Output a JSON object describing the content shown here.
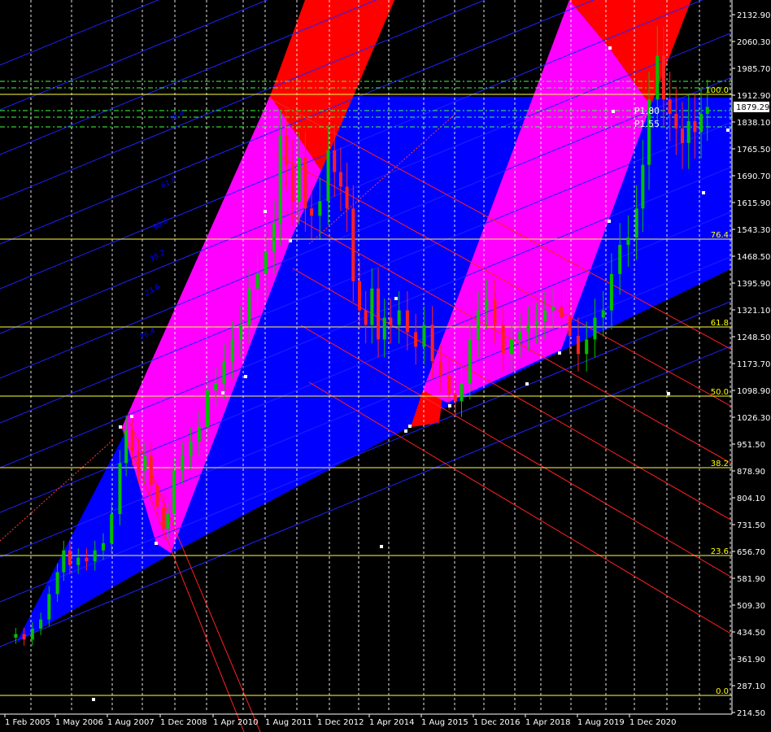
{
  "chart_data": {
    "type": "candlestick",
    "instrument": "",
    "price_axis": {
      "ticks": [
        "2132.90",
        "2060.30",
        "1985.70",
        "1912.90",
        "1838.10",
        "1765.50",
        "1690.70",
        "1615.90",
        "1543.30",
        "1468.50",
        "1395.90",
        "1321.10",
        "1248.50",
        "1173.70",
        "1098.90",
        "1026.30",
        "951.50",
        "878.90",
        "804.10",
        "731.50",
        "656.70",
        "581.90",
        "509.30",
        "434.50",
        "361.90",
        "287.10",
        "214.50"
      ],
      "ylim": [
        214.5,
        2132.9
      ],
      "current_price": "1879.29"
    },
    "time_axis": {
      "labels": [
        "1 Feb 2005",
        "1 May 2006",
        "1 Aug 2007",
        "1 Dec 2008",
        "1 Apr 2010",
        "1 Aug 2011",
        "1 Dec 2012",
        "1 Apr 2014",
        "1 Aug 2015",
        "1 Dec 2016",
        "1 Apr 2018",
        "1 Aug 2019",
        "1 Dec 2020"
      ]
    },
    "fib_levels": [
      {
        "label": "100.0",
        "price": 1900
      },
      {
        "label": "76.4",
        "price": 1520
      },
      {
        "label": "61.8",
        "price": 1276
      },
      {
        "label": "50.0",
        "price": 1087
      },
      {
        "label": "38.2",
        "price": 895
      },
      {
        "label": "23.6",
        "price": 658
      },
      {
        "label": "0.0",
        "price": 272
      }
    ],
    "fan_labels": [
      "76.4",
      "61.8",
      "50.0",
      "38.2",
      "23.6",
      "76.4"
    ],
    "annotation_labels": [
      "P1.80",
      "P1.55"
    ],
    "price_series": [
      [
        2005.0,
        420
      ],
      [
        2005.2,
        430
      ],
      [
        2005.4,
        415
      ],
      [
        2005.6,
        445
      ],
      [
        2005.8,
        470
      ],
      [
        2006.0,
        540
      ],
      [
        2006.2,
        600
      ],
      [
        2006.35,
        660
      ],
      [
        2006.5,
        620
      ],
      [
        2006.7,
        640
      ],
      [
        2006.9,
        630
      ],
      [
        2007.1,
        660
      ],
      [
        2007.3,
        680
      ],
      [
        2007.5,
        760
      ],
      [
        2007.7,
        900
      ],
      [
        2007.85,
        990
      ],
      [
        2008.0,
        930
      ],
      [
        2008.15,
        880
      ],
      [
        2008.3,
        920
      ],
      [
        2008.45,
        840
      ],
      [
        2008.6,
        780
      ],
      [
        2008.75,
        720
      ],
      [
        2008.85,
        760
      ],
      [
        2009.0,
        880
      ],
      [
        2009.2,
        920
      ],
      [
        2009.4,
        960
      ],
      [
        2009.6,
        1000
      ],
      [
        2009.8,
        1100
      ],
      [
        2010.0,
        1120
      ],
      [
        2010.2,
        1180
      ],
      [
        2010.4,
        1240
      ],
      [
        2010.6,
        1280
      ],
      [
        2010.8,
        1380
      ],
      [
        2011.0,
        1420
      ],
      [
        2011.2,
        1480
      ],
      [
        2011.4,
        1560
      ],
      [
        2011.55,
        1800
      ],
      [
        2011.7,
        1720
      ],
      [
        2011.85,
        1620
      ],
      [
        2012.0,
        1740
      ],
      [
        2012.15,
        1600
      ],
      [
        2012.3,
        1580
      ],
      [
        2012.5,
        1620
      ],
      [
        2012.7,
        1760
      ],
      [
        2012.85,
        1700
      ],
      [
        2013.0,
        1660
      ],
      [
        2013.15,
        1600
      ],
      [
        2013.3,
        1400
      ],
      [
        2013.45,
        1320
      ],
      [
        2013.6,
        1280
      ],
      [
        2013.75,
        1380
      ],
      [
        2013.9,
        1240
      ],
      [
        2014.05,
        1300
      ],
      [
        2014.2,
        1280
      ],
      [
        2014.4,
        1320
      ],
      [
        2014.6,
        1260
      ],
      [
        2014.8,
        1220
      ],
      [
        2015.0,
        1280
      ],
      [
        2015.2,
        1180
      ],
      [
        2015.4,
        1140
      ],
      [
        2015.6,
        1090
      ],
      [
        2015.75,
        1070
      ],
      [
        2015.9,
        1120
      ],
      [
        2016.1,
        1240
      ],
      [
        2016.3,
        1320
      ],
      [
        2016.5,
        1350
      ],
      [
        2016.7,
        1280
      ],
      [
        2016.9,
        1200
      ],
      [
        2017.1,
        1240
      ],
      [
        2017.3,
        1260
      ],
      [
        2017.5,
        1280
      ],
      [
        2017.7,
        1290
      ],
      [
        2017.9,
        1320
      ],
      [
        2018.1,
        1330
      ],
      [
        2018.3,
        1300
      ],
      [
        2018.5,
        1250
      ],
      [
        2018.7,
        1200
      ],
      [
        2018.9,
        1240
      ],
      [
        2019.1,
        1300
      ],
      [
        2019.3,
        1320
      ],
      [
        2019.5,
        1420
      ],
      [
        2019.7,
        1500
      ],
      [
        2019.9,
        1520
      ],
      [
        2020.1,
        1600
      ],
      [
        2020.25,
        1720
      ],
      [
        2020.4,
        1900
      ],
      [
        2020.6,
        2020
      ],
      [
        2020.75,
        1900
      ],
      [
        2020.9,
        1860
      ],
      [
        2021.05,
        1820
      ],
      [
        2021.2,
        1780
      ],
      [
        2021.35,
        1840
      ],
      [
        2021.5,
        1810
      ],
      [
        2021.65,
        1860
      ],
      [
        2021.8,
        1879
      ]
    ],
    "x_range": [
      2004.9,
      2022.0
    ],
    "grid": true
  }
}
